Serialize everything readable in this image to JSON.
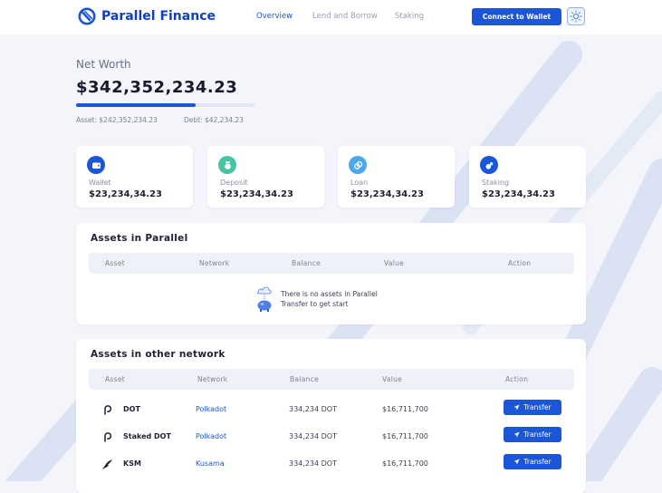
{
  "brand": {
    "name": "Parallel Finance",
    "logo_icon": "parallel-logo-icon",
    "color": "#0f3fbf"
  },
  "nav": [
    {
      "label": "Overview",
      "active": true
    },
    {
      "label": "Lend and Borrow",
      "active": false
    },
    {
      "label": "Staking",
      "active": false
    }
  ],
  "header": {
    "connect_label": "Connect to Wallet",
    "theme_icon": "sun-icon"
  },
  "colors": {
    "accent": "#1a56d6",
    "background": "#f3f5fb",
    "card": "#ffffff",
    "muted": "#7b8096"
  },
  "net_worth": {
    "title": "Net Worth",
    "value": "$342,352,234.23",
    "progress": 0.67,
    "asset_label": "Asset: $242,352,234.23",
    "debt_label": "Debt: $42,234.23"
  },
  "stats": [
    {
      "label": "Wallet",
      "value": "$23,234,34.23",
      "icon": "wallet-icon",
      "icon_color": "#1a56d6"
    },
    {
      "label": "Deposit",
      "value": "$23,234,34.23",
      "icon": "deposit-icon",
      "icon_color": "#49c3a6"
    },
    {
      "label": "Loan",
      "value": "$23,234,34.23",
      "icon": "loan-icon",
      "icon_color": "#4da8ea"
    },
    {
      "label": "Staking",
      "value": "$23,234,34.23",
      "icon": "staking-icon",
      "icon_color": "#1a56d6"
    }
  ],
  "parallel_assets": {
    "title": "Assets in Parallel",
    "columns": [
      "Asset",
      "Network",
      "Balance",
      "Value",
      "Action"
    ],
    "empty_line1": "There is no assets in Parallel",
    "empty_line2": "Transfer to get start",
    "empty_icon": "piggy-bank-icon"
  },
  "other_assets": {
    "title": "Assets in other network",
    "columns": [
      "Asset",
      "Network",
      "Balance",
      "Value",
      "Action"
    ],
    "rows": [
      {
        "asset": "DOT",
        "network": "Polkadot",
        "balance": "334,234 DOT",
        "value": "$16,711,700",
        "action": "Transfer",
        "icon": "polkadot-icon"
      },
      {
        "asset": "Staked DOT",
        "network": "Polkadot",
        "balance": "334,234 DOT",
        "value": "$16,711,700",
        "action": "Transfer",
        "icon": "polkadot-icon"
      },
      {
        "asset": "KSM",
        "network": "Kusama",
        "balance": "334,234 DOT",
        "value": "$16,711,700",
        "action": "Transfer",
        "icon": "kusama-icon"
      }
    ]
  }
}
